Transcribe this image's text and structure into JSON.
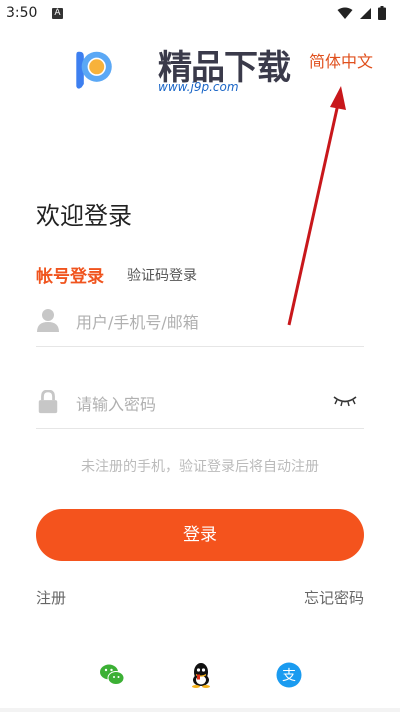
{
  "status_bar": {
    "time": "3:50",
    "notification_letter": "A"
  },
  "logo": {
    "brand": "精品下载",
    "url": "www.j9p.com"
  },
  "language_link": "简体中文",
  "welcome_title": "欢迎登录",
  "tabs": {
    "account": "帐号登录",
    "code": "验证码登录"
  },
  "username_field": {
    "placeholder": "用户/手机号/邮箱",
    "value": ""
  },
  "password_field": {
    "placeholder": "请输入密码",
    "value": ""
  },
  "hint": "未注册的手机，验证登录后将自动注册",
  "login_button": "登录",
  "register_link": "注册",
  "forgot_link": "忘记密码",
  "colors": {
    "accent": "#f4531d",
    "link": "#e0501d"
  },
  "social_logins": [
    "wechat-icon",
    "qq-icon",
    "alipay-icon"
  ]
}
